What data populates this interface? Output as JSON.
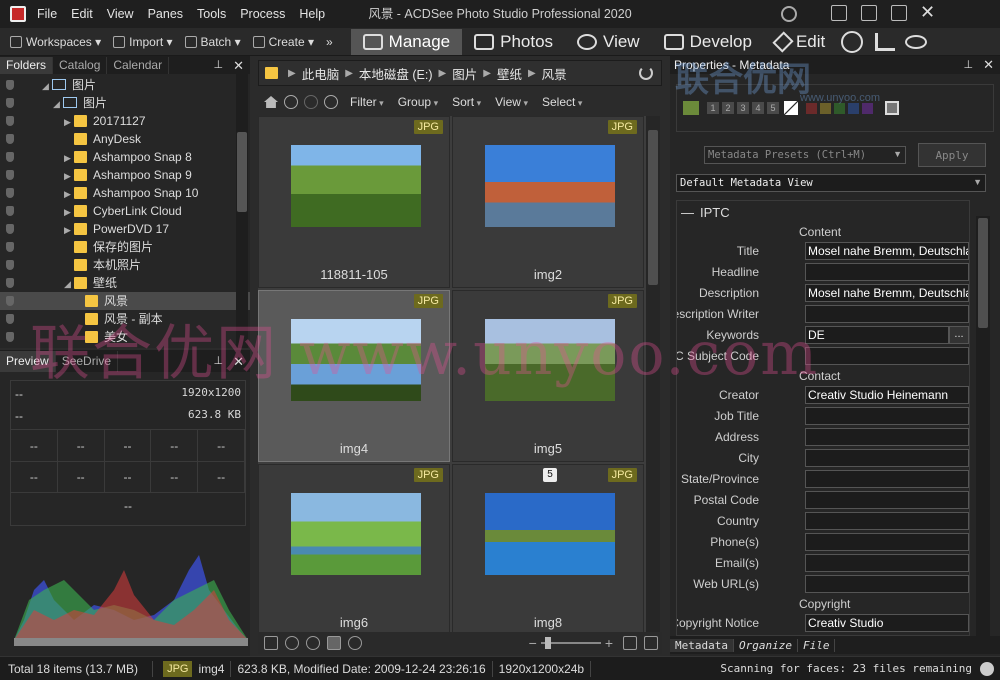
{
  "window": {
    "title": "风景 - ACDSee Photo Studio Professional 2020",
    "menu": [
      "File",
      "Edit",
      "View",
      "Panes",
      "Tools",
      "Process",
      "Help"
    ]
  },
  "toolbar": {
    "items": [
      "Workspaces",
      "Import",
      "Batch",
      "Create"
    ],
    "modes": [
      "Manage",
      "Photos",
      "View",
      "Develop",
      "Edit"
    ],
    "active_mode": "Manage",
    "more_label": "»"
  },
  "folders_panel": {
    "tabs": [
      "Folders",
      "Catalog",
      "Calendar"
    ],
    "tree": [
      {
        "label": "图片",
        "depth": 0,
        "icon": "computer-icon",
        "arrow": "◢"
      },
      {
        "label": "图片",
        "depth": 1,
        "icon": "picture-library-icon",
        "arrow": "◢"
      },
      {
        "label": "20171127",
        "depth": 2,
        "icon": "folder-icon",
        "arrow": "▶"
      },
      {
        "label": "AnyDesk",
        "depth": 2,
        "icon": "folder-icon",
        "arrow": ""
      },
      {
        "label": "Ashampoo Snap 8",
        "depth": 2,
        "icon": "folder-icon",
        "arrow": "▶"
      },
      {
        "label": "Ashampoo Snap 9",
        "depth": 2,
        "icon": "folder-icon",
        "arrow": "▶"
      },
      {
        "label": "Ashampoo Snap 10",
        "depth": 2,
        "icon": "folder-icon",
        "arrow": "▶"
      },
      {
        "label": "CyberLink Cloud",
        "depth": 2,
        "icon": "folder-icon",
        "arrow": "▶"
      },
      {
        "label": "PowerDVD 17",
        "depth": 2,
        "icon": "folder-icon",
        "arrow": "▶"
      },
      {
        "label": "保存的图片",
        "depth": 2,
        "icon": "folder-icon",
        "arrow": ""
      },
      {
        "label": "本机照片",
        "depth": 2,
        "icon": "folder-icon",
        "arrow": ""
      },
      {
        "label": "壁纸",
        "depth": 2,
        "icon": "folder-icon",
        "arrow": "◢"
      },
      {
        "label": "风景",
        "depth": 3,
        "icon": "folder-icon",
        "arrow": "",
        "selected": true
      },
      {
        "label": "风景 - 副本",
        "depth": 3,
        "icon": "folder-icon",
        "arrow": ""
      },
      {
        "label": "美女",
        "depth": 3,
        "icon": "folder-icon",
        "arrow": ""
      }
    ]
  },
  "preview_panel": {
    "tabs": [
      "Preview",
      "SeeDrive"
    ],
    "top_left": "--",
    "mid_left": "--",
    "dimensions": "1920x1200",
    "filesize": "623.8 KB",
    "cells_row1": [
      "--",
      "--",
      "--",
      "--",
      "--"
    ],
    "cells_row2": [
      "--",
      "--",
      "--",
      "--",
      "--"
    ],
    "footer": "--"
  },
  "breadcrumb": [
    "此电脑",
    "本地磁盘 (E:)",
    "图片",
    "壁纸",
    "风景"
  ],
  "filterbar": [
    "Filter",
    "Group",
    "Sort",
    "View",
    "Select"
  ],
  "thumbnails": [
    {
      "name": "118811-105",
      "badge": "JPG",
      "scene": "hills"
    },
    {
      "name": "img2",
      "badge": "JPG",
      "scene": "town"
    },
    {
      "name": "img4",
      "badge": "JPG",
      "scene": "lake",
      "selected": true
    },
    {
      "name": "img5",
      "badge": "JPG",
      "scene": "vineyard"
    },
    {
      "name": "img6",
      "badge": "JPG",
      "scene": "stream"
    },
    {
      "name": "img8",
      "badge": "JPG",
      "scene": "castle",
      "number": "5"
    }
  ],
  "properties": {
    "title": "Properties - Metadata",
    "presets_placeholder": "Metadata Presets (Ctrl+M)",
    "apply_label": "Apply",
    "view_select": "Default Metadata View",
    "section": "IPTC",
    "rating_numbers": [
      "1",
      "2",
      "3",
      "4",
      "5"
    ],
    "groups": {
      "content": "Content",
      "contact": "Contact",
      "copyright": "Copyright"
    },
    "fields_content": [
      {
        "label": "Title",
        "value": "Mosel nahe Bremm, Deutschland"
      },
      {
        "label": "Headline",
        "value": ""
      },
      {
        "label": "Description",
        "value": "Mosel nahe Bremm, Deutschland"
      },
      {
        "label": "Description Writer",
        "value": ""
      },
      {
        "label": "Keywords",
        "value": "DE"
      },
      {
        "label": "IPTC Subject Code",
        "value": ""
      }
    ],
    "fields_contact": [
      {
        "label": "Creator",
        "value": "Creativ Studio Heinemann"
      },
      {
        "label": "Job Title",
        "value": ""
      },
      {
        "label": "Address",
        "value": ""
      },
      {
        "label": "City",
        "value": ""
      },
      {
        "label": "State/Province",
        "value": ""
      },
      {
        "label": "Postal Code",
        "value": ""
      },
      {
        "label": "Country",
        "value": ""
      },
      {
        "label": "Phone(s)",
        "value": ""
      },
      {
        "label": "Email(s)",
        "value": ""
      },
      {
        "label": "Web URL(s)",
        "value": ""
      }
    ],
    "fields_copyright": [
      {
        "label": "Copyright Notice",
        "value": "Creativ Studio"
      }
    ],
    "keywords_more": "..."
  },
  "right_tabs": [
    "Metadata",
    "Organize",
    "File"
  ],
  "status": {
    "total": "Total 18 items  (13.7 MB)",
    "type": "JPG",
    "filename": "img4",
    "details": "623.8 KB, Modified Date: 2009-12-24 23:26:16",
    "resolution": "1920x1200x24b",
    "scanning": "Scanning for faces: 23 files remaining"
  },
  "watermark": {
    "text": "联合优网 www.unyoo.com",
    "logo": "联合优网",
    "logo_url": "www.unyoo.com"
  },
  "colors": {
    "accent": "#555555",
    "badge": "#6d6a1e",
    "folder": "#f5c542"
  }
}
